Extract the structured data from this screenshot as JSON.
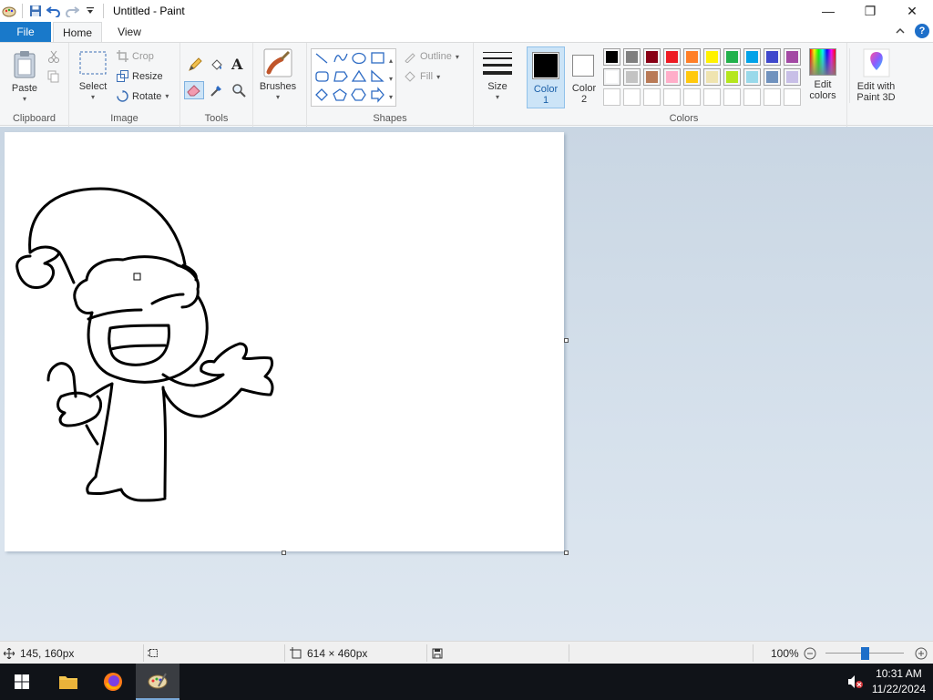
{
  "window": {
    "title": "Untitled - Paint",
    "minimize": "—",
    "maximize": "❐",
    "close": "✕"
  },
  "tabs": {
    "file": "File",
    "home": "Home",
    "view": "View"
  },
  "ribbon": {
    "clipboard": {
      "label": "Clipboard",
      "paste": "Paste"
    },
    "image": {
      "label": "Image",
      "select": "Select",
      "crop": "Crop",
      "resize": "Resize",
      "rotate": "Rotate"
    },
    "tools": {
      "label": "Tools"
    },
    "brushes": {
      "label": "Brushes"
    },
    "shapes": {
      "label": "Shapes",
      "outline": "Outline",
      "fill": "Fill"
    },
    "size": {
      "label": "Size"
    },
    "color1": {
      "line1": "Color",
      "line2": "1"
    },
    "color2": {
      "line1": "Color",
      "line2": "2"
    },
    "colors": {
      "label": "Colors",
      "row1": [
        "#000000",
        "#7f7f7f",
        "#880015",
        "#ed1c24",
        "#ff7f27",
        "#fff200",
        "#22b14c",
        "#00a2e8",
        "#3f48cc",
        "#a349a4"
      ],
      "row2": [
        "#ffffff",
        "#c3c3c3",
        "#b97a57",
        "#ffaec9",
        "#ffc90e",
        "#efe4b0",
        "#b5e61d",
        "#99d9ea",
        "#7092be",
        "#c8bfe7"
      ],
      "row3": [
        "",
        "",
        "",
        "",
        "",
        "",
        "",
        "",
        "",
        ""
      ],
      "primary": "#000000",
      "secondary": "#ffffff"
    },
    "edit_colors": {
      "line1": "Edit",
      "line2": "colors"
    },
    "paint3d": {
      "line1": "Edit with",
      "line2": "Paint 3D"
    }
  },
  "status": {
    "cursor_position": "145, 160px",
    "canvas_size": "614 × 460px",
    "zoom": "100%",
    "zoom_slider_level": 0.5
  },
  "taskbar": {
    "time": "10:31 AM",
    "date": "11/22/2024"
  },
  "accent": "#1979ca"
}
